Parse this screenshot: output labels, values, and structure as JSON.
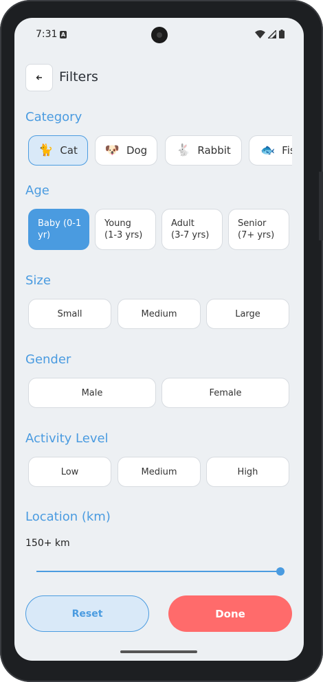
{
  "status_bar": {
    "time": "7:31",
    "badge": "A"
  },
  "header": {
    "title": "Filters"
  },
  "sections": {
    "category": "Category",
    "age": "Age",
    "size": "Size",
    "gender": "Gender",
    "activity": "Activity Level",
    "location": "Location (km)"
  },
  "categories": [
    {
      "label": "Cat",
      "icon": "🐈",
      "selected": true
    },
    {
      "label": "Dog",
      "icon": "🐶",
      "selected": false
    },
    {
      "label": "Rabbit",
      "icon": "🐇",
      "selected": false
    },
    {
      "label": "Fish",
      "icon": "🐟",
      "selected": false
    }
  ],
  "ages": [
    {
      "line1": "Baby (0-1",
      "line2": "yr)",
      "selected": true
    },
    {
      "line1": "Young",
      "line2": "(1-3 yrs)",
      "selected": false
    },
    {
      "line1": "Adult",
      "line2": "(3-7 yrs)",
      "selected": false
    },
    {
      "line1": "Senior",
      "line2": "(7+ yrs)",
      "selected": false
    }
  ],
  "sizes": [
    "Small",
    "Medium",
    "Large"
  ],
  "genders": [
    "Male",
    "Female"
  ],
  "activity_levels": [
    "Low",
    "Medium",
    "High"
  ],
  "location": {
    "value_text": "150+ km",
    "slider_fraction": 1.0
  },
  "buttons": {
    "reset": "Reset",
    "done": "Done"
  },
  "colors": {
    "accent": "#4a9be0",
    "done": "#ff6b6b",
    "background": "#edf0f3"
  }
}
